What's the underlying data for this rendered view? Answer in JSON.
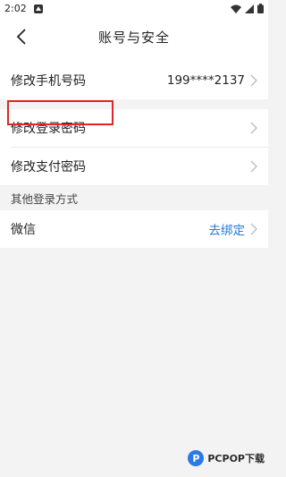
{
  "status_bar": {
    "time": "2:02"
  },
  "header": {
    "title": "账号与安全"
  },
  "rows": {
    "phone": {
      "label": "修改手机号码",
      "value": "199****2137"
    },
    "login_password": {
      "label": "修改登录密码"
    },
    "pay_password": {
      "label": "修改支付密码"
    }
  },
  "other_login": {
    "section_label": "其他登录方式",
    "wechat": {
      "label": "微信",
      "value": "去绑定"
    }
  },
  "watermark": {
    "text": "PCPOP下载"
  },
  "colors": {
    "link": "#1e7be0",
    "highlight": "#e02525",
    "background": "#f3f3f3"
  }
}
